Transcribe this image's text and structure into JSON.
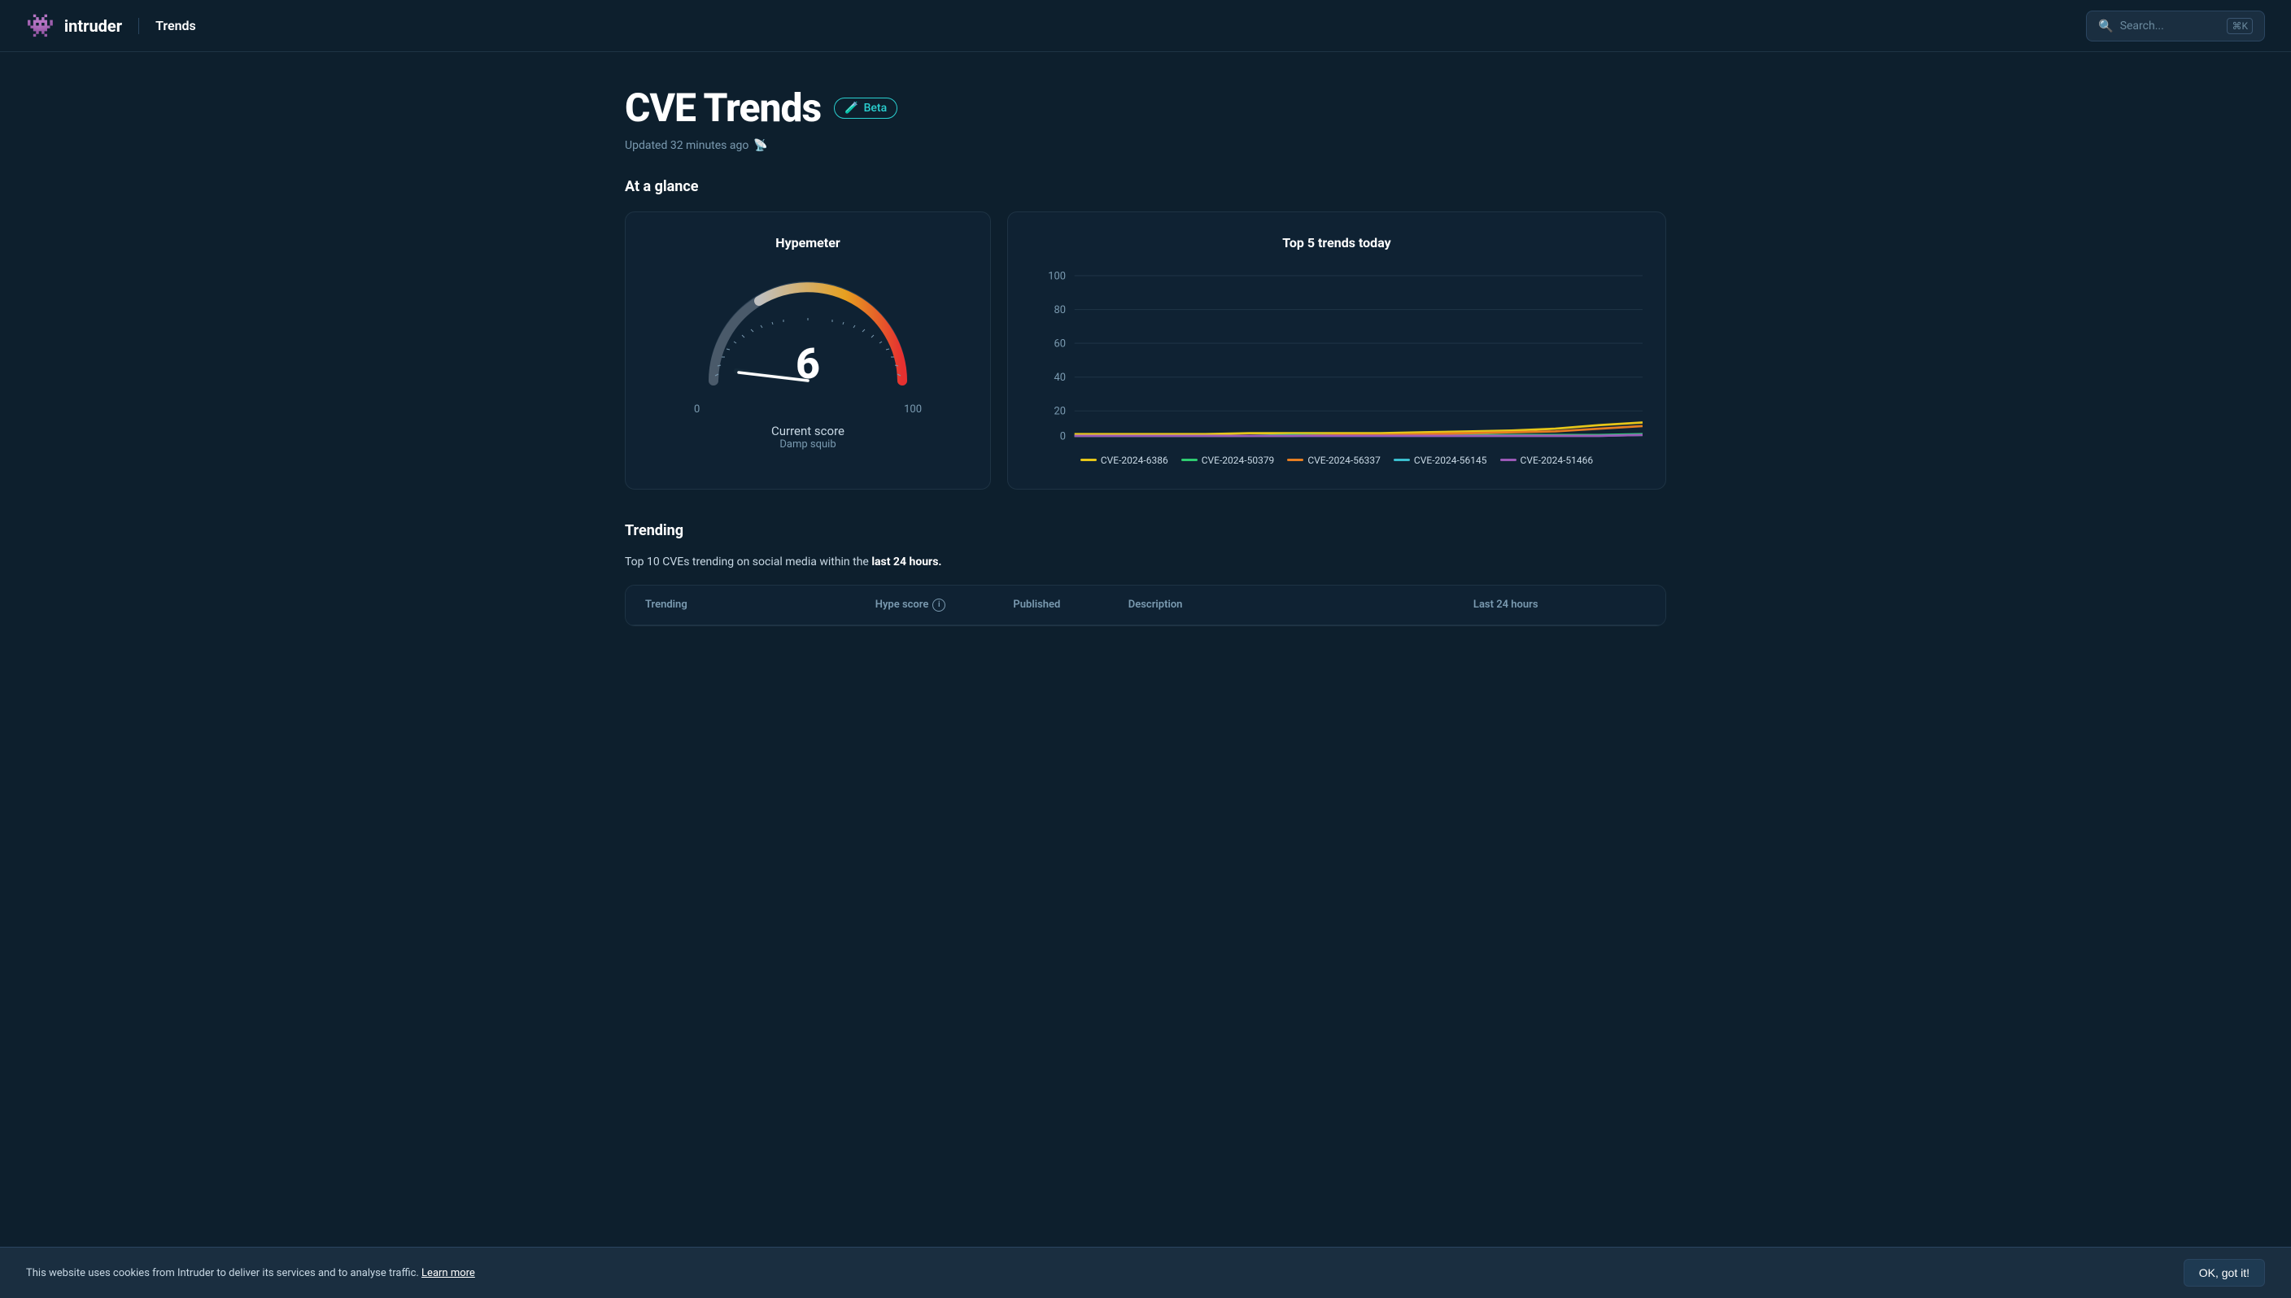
{
  "nav": {
    "logo_icon": "👾",
    "logo_text": "intruder",
    "page_title": "Trends",
    "search_placeholder": "Search...",
    "search_shortcut": "⌘K"
  },
  "page": {
    "title": "CVE Trends",
    "beta_label": "Beta",
    "updated_text": "Updated 32 minutes ago"
  },
  "at_a_glance": {
    "section_title": "At a glance",
    "hypemeter": {
      "title": "Hypemeter",
      "score": "6",
      "current_score_label": "Current score",
      "sub_label": "Damp squib",
      "min": "0",
      "max": "100"
    },
    "top5": {
      "title": "Top 5 trends today",
      "y_labels": [
        "100",
        "80",
        "60",
        "40",
        "20",
        "0"
      ],
      "legend": [
        {
          "id": "CVE-2024-6386",
          "color": "#e6c619"
        },
        {
          "id": "CVE-2024-50379",
          "color": "#2ecc71"
        },
        {
          "id": "CVE-2024-56337",
          "color": "#e67e22"
        },
        {
          "id": "CVE-2024-56145",
          "color": "#3bbfcf"
        },
        {
          "id": "CVE-2024-51466",
          "color": "#9b59b6"
        }
      ]
    }
  },
  "trending": {
    "section_title": "Trending",
    "subtitle_plain": "Top 10 CVEs trending on social media within the ",
    "subtitle_bold": "last 24 hours.",
    "columns": {
      "trending": "Trending",
      "hype_score": "Hype score",
      "published": "Published",
      "description": "Description",
      "last_24h": "Last 24 hours"
    }
  },
  "cookie": {
    "text": "This website uses cookies from Intruder to deliver its services and to analyse traffic.",
    "link_text": "Learn more",
    "button_label": "OK, got it!"
  }
}
